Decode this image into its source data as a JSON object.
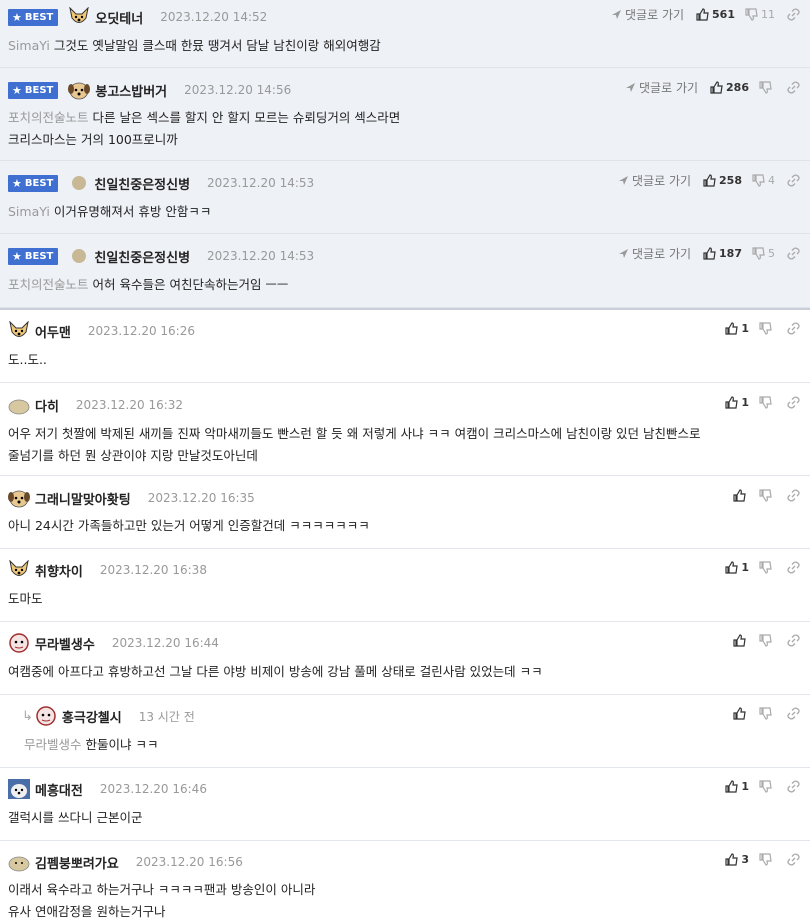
{
  "labels": {
    "best": "BEST",
    "goto": "댓글로 가기"
  },
  "best_comments": [
    {
      "nick": "오딧테너",
      "time": "2023.12.20 14:52",
      "mention": "SimaYi",
      "text": [
        "그것도 옛날말임 클스때 한뮸 땡겨서 담날 남친이랑 해외여행감"
      ],
      "up": "561",
      "down": "11"
    },
    {
      "nick": "봉고스밥버거",
      "time": "2023.12.20 14:56",
      "mention": "포치의전술노트",
      "text": [
        "다른 날은 섹스를 할지 안 할지 모르는 슈뢰딩거의 섹스라면",
        "크리스마스는 거의 100프로니까"
      ],
      "up": "286",
      "down": ""
    },
    {
      "nick": "친일친중은정신병",
      "time": "2023.12.20 14:53",
      "mention": "SimaYi",
      "text": [
        "이거유명해져서 휴방 안함ㅋㅋ"
      ],
      "up": "258",
      "down": "4"
    },
    {
      "nick": "친일친중은정신병",
      "time": "2023.12.20 14:53",
      "mention": "포치의전술노트",
      "text": [
        "어허 육수들은 여친단속하는거임 ㅡㅡ"
      ],
      "up": "187",
      "down": "5"
    }
  ],
  "comments": [
    {
      "nick": "어두맨",
      "time": "2023.12.20 16:26",
      "text": [
        "도..도.."
      ],
      "up": "1"
    },
    {
      "nick": "다히",
      "time": "2023.12.20 16:32",
      "text": [
        "어우 저기 첫짤에 박제된 새끼들 진짜 악마새끼들도 빤스런 할 듯 왜 저렇게 사냐 ㅋㅋ 여캠이 크리스마스에 남친이랑 있던 남친빤스로",
        "줄넘기를 하던 뭔 상관이야 지랑 만날것도아닌데"
      ],
      "up": "1"
    },
    {
      "nick": "그래니말맞아홧팅",
      "time": "2023.12.20 16:35",
      "text": [
        "아니 24시간 가족들하고만 있는거 어떻게 인증할건데 ㅋㅋㅋㅋㅋㅋㅋ"
      ],
      "up": ""
    },
    {
      "nick": "취향차이",
      "time": "2023.12.20 16:38",
      "text": [
        "도마도"
      ],
      "up": "1"
    },
    {
      "nick": "무라벨생수",
      "time": "2023.12.20 16:44",
      "text": [
        "여캠중에 아프다고 휴방하고선 그날 다른 야방 비제이 방송에 강남 풀메 상태로 걸린사람 있었는데 ㅋㅋ"
      ],
      "up": ""
    },
    {
      "nick": "홍극강첼시",
      "time": "13 시간 전",
      "mention": "무라벨생수",
      "text": [
        "한둘이냐 ㅋㅋ"
      ],
      "up": ""
    },
    {
      "nick": "메흥대전",
      "time": "2023.12.20 16:46",
      "text": [
        "갤럭시를 쓰다니 근본이군"
      ],
      "up": "1"
    },
    {
      "nick": "김펨붕뽀려가요",
      "time": "2023.12.20 16:56",
      "text": [
        "이래서 육수라고 하는거구나 ㅋㅋㅋㅋ팬과 방송인이 아니라",
        "유사 연애감정을 원하는거구나"
      ],
      "up": "3"
    }
  ],
  "colors": {
    "best_badge": "#3f6fd0",
    "best_bg": "#eef1f6",
    "mention": "#999999"
  }
}
